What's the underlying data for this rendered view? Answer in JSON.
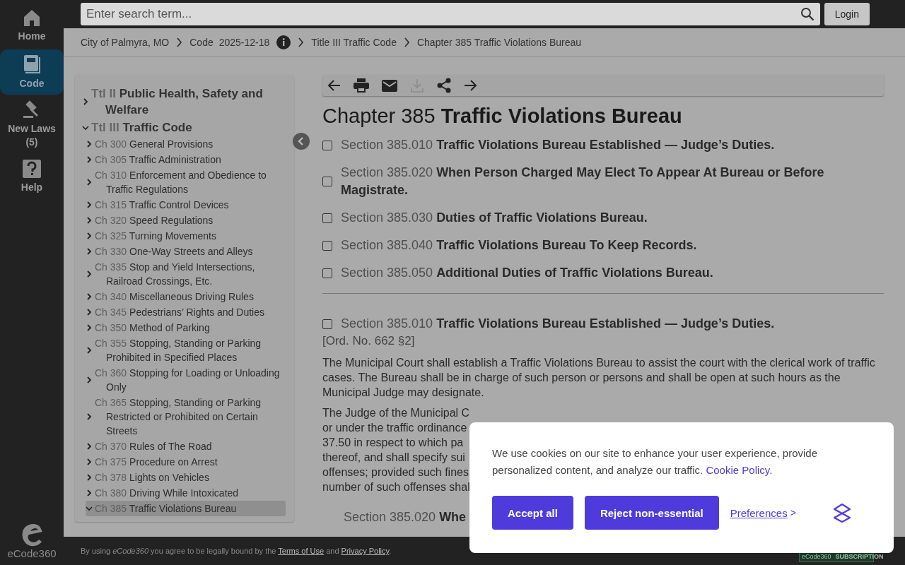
{
  "nav": [
    {
      "kind": "home",
      "label": "Home",
      "selected": false
    },
    {
      "kind": "code",
      "label": "Code",
      "selected": true
    },
    {
      "kind": "laws",
      "label": "New Laws",
      "count": "(5)",
      "selected": false
    },
    {
      "kind": "help",
      "label": "Help",
      "selected": false
    }
  ],
  "logo": {
    "text": "eCode360"
  },
  "search": {
    "placeholder": "Enter search term..."
  },
  "login": "Login",
  "breadcrumb": [
    {
      "label": "City of Palmyra, MO"
    },
    {
      "label": "Code",
      "date": "2025-12-18"
    },
    {
      "label": "Title III Traffic Code"
    },
    {
      "label": "Chapter 385 Traffic Violations Bureau"
    }
  ],
  "toc": [
    {
      "prefix": "Ttl II",
      "title": "Public Health, Safety and Welfare",
      "expanded": false,
      "selected": false
    },
    {
      "prefix": "Ttl III",
      "title": "Traffic Code",
      "expanded": true,
      "selected": false,
      "children": [
        {
          "prefix": "Ch 300",
          "title": "General Provisions",
          "expanded": false,
          "selected": false
        },
        {
          "prefix": "Ch 305",
          "title": "Traffic Administration",
          "expanded": false,
          "selected": false
        },
        {
          "prefix": "Ch 310",
          "title": "Enforcement and Obedience to Traffic Regulations",
          "expanded": false,
          "selected": false
        },
        {
          "prefix": "Ch 315",
          "title": "Traffic Control Devices",
          "expanded": false,
          "selected": false
        },
        {
          "prefix": "Ch 320",
          "title": "Speed Regulations",
          "expanded": false,
          "selected": false
        },
        {
          "prefix": "Ch 325",
          "title": "Turning Movements",
          "expanded": false,
          "selected": false
        },
        {
          "prefix": "Ch 330",
          "title": "One-Way Streets and Alleys",
          "expanded": false,
          "selected": false
        },
        {
          "prefix": "Ch 335",
          "title": "Stop and Yield Intersections, Railroad Crossings, Etc.",
          "expanded": false,
          "selected": false
        },
        {
          "prefix": "Ch 340",
          "title": "Miscellaneous Driving Rules",
          "expanded": false,
          "selected": false
        },
        {
          "prefix": "Ch 345",
          "title": "Pedestrians’ Rights and Duties",
          "expanded": false,
          "selected": false
        },
        {
          "prefix": "Ch 350",
          "title": "Method of Parking",
          "expanded": false,
          "selected": false
        },
        {
          "prefix": "Ch 355",
          "title": "Stopping, Standing or Parking Prohibited in Specified Places",
          "expanded": false,
          "selected": false
        },
        {
          "prefix": "Ch 360",
          "title": "Stopping for Loading or Unloading Only",
          "expanded": false,
          "selected": false
        },
        {
          "prefix": "Ch 365",
          "title": "Stopping, Standing or Parking Restricted or Prohibited on Certain Streets",
          "expanded": false,
          "selected": false
        },
        {
          "prefix": "Ch 370",
          "title": "Rules of The Road",
          "expanded": false,
          "selected": false
        },
        {
          "prefix": "Ch 375",
          "title": "Procedure on Arrest",
          "expanded": false,
          "selected": false
        },
        {
          "prefix": "Ch 378",
          "title": "Lights on Vehicles",
          "expanded": false,
          "selected": false
        },
        {
          "prefix": "Ch 380",
          "title": "Driving While Intoxicated",
          "expanded": false,
          "selected": false
        },
        {
          "prefix": "Ch 385",
          "title": "Traffic Violations Bureau",
          "expanded": true,
          "selected": true
        }
      ]
    }
  ],
  "toolbar": [
    {
      "kind": "back",
      "disabled": false
    },
    {
      "kind": "print",
      "disabled": false
    },
    {
      "kind": "email",
      "disabled": false
    },
    {
      "kind": "download",
      "disabled": true
    },
    {
      "kind": "share",
      "disabled": false
    },
    {
      "kind": "forward",
      "disabled": false
    }
  ],
  "chapter": {
    "number": "Chapter 385",
    "title": "Traffic Violations Bureau"
  },
  "sections": [
    {
      "number": "Section 385.010",
      "title": "Traffic Violations Bureau Established — Judge’s Duties.",
      "checked": false
    },
    {
      "number": "Section 385.020",
      "title": "When Person Charged May Elect To Appear At Bureau or Before Magistrate.",
      "checked": false
    },
    {
      "number": "Section 385.030",
      "title": "Duties of Traffic Violations Bureau.",
      "checked": false
    },
    {
      "number": "Section 385.040",
      "title": "Traffic Violations Bureau To Keep Records.",
      "checked": false
    },
    {
      "number": "Section 385.050",
      "title": "Additional Duties of Traffic Violations Bureau.",
      "checked": false
    }
  ],
  "detail": {
    "number": "Section 385.010",
    "title": "Traffic Violations Bureau Established — Judge’s Duties.",
    "checked": false,
    "history": "[Ord. No. 662 §2]",
    "paragraph": "The Municipal Court shall establish a Traffic Violations Bureau to assist the court with the clerical work of traffic cases. The Bureau shall be in charge of such person or persons and shall be open at such hours as the Municipal Judge may designate.",
    "cut_lines": [
      "The Judge of the Municipal C",
      "or under the traffic ordinance",
      "37.50 in respect to which pa",
      "thereof, and shall specify sui",
      "offenses; provided such fines",
      "number of such offenses shal"
    ],
    "next_number": "Section 385.020",
    "next_title": "Whe"
  },
  "footer": {
    "before": "By using *eCode360* you agree to be legally bound by the",
    "terms": "Terms of Use",
    "joiner": "and",
    "privacy": "Privacy Policy",
    "end": "."
  },
  "badge": {
    "brand": "eCode360",
    "label": "SUBSCRIPTION"
  },
  "cookie": {
    "text": "We use cookies on our site to enhance your user experience, provide personalized content, and analyze our traffic.",
    "policy": "Cookie Policy.",
    "accept": "Accept all",
    "reject": "Reject non-essential",
    "preferences": "Preferences",
    "pref_arrow": ">"
  }
}
